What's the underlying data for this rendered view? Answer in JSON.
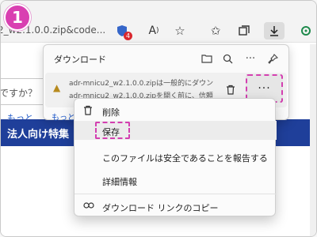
{
  "step": {
    "number": "1"
  },
  "toolbar": {
    "address_text": "2_w2.1.0.0.zip&code...",
    "badge_count": "4",
    "icons": [
      "tracking-prevention-icon",
      "read-aloud-icon",
      "favorite-star-icon",
      "favorites-icon",
      "collections-icon",
      "downloads-icon",
      "extension-icon"
    ]
  },
  "page": {
    "input_text": "ですか？",
    "link_text": "もっと",
    "banner_text": "法人向け特集"
  },
  "downloads": {
    "title": "ダウンロード",
    "file_line1": "adr-mnicu2_w2.1.0.0.zipは一般的にダウン",
    "file_line2": "adr-mnicu2_w2.1.0.0.zipを開く前に、信頼",
    "more_label": "···"
  },
  "context_menu": {
    "items": [
      {
        "label": "削除",
        "icon": "trash-icon"
      },
      {
        "label": "保存",
        "icon": ""
      },
      {
        "label": "このファイルは安全であることを報告する",
        "icon": ""
      },
      {
        "label": "詳細情報",
        "icon": ""
      },
      {
        "label": "ダウンロード リンクのコピー",
        "icon": "link-icon"
      }
    ]
  },
  "colors": {
    "accent_highlight": "#d33fb0",
    "banner": "#1f3f9a",
    "link": "#1c56c7"
  }
}
